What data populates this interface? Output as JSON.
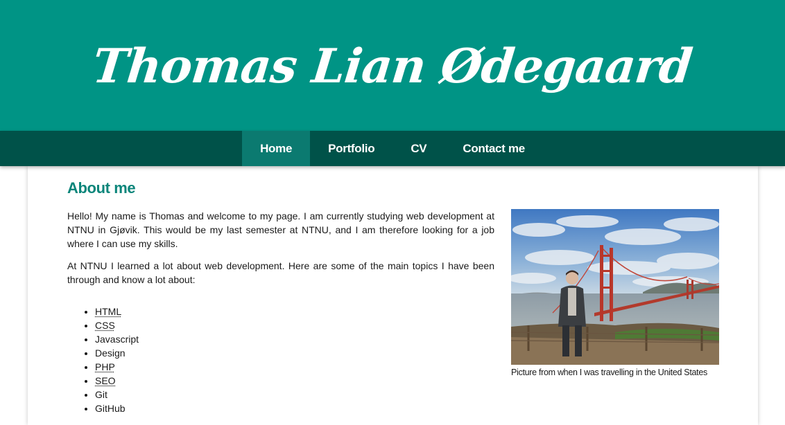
{
  "header": {
    "title": "Thomas Lian Ødegaard"
  },
  "nav": {
    "items": [
      {
        "label": "Home",
        "active": true
      },
      {
        "label": "Portfolio",
        "active": false
      },
      {
        "label": "CV",
        "active": false
      },
      {
        "label": "Contact me",
        "active": false
      }
    ]
  },
  "about": {
    "heading": "About me",
    "paragraphs": [
      "Hello! My name is Thomas and welcome to my page. I am currently studying web development at NTNU in Gjøvik. This would be my last semester at NTNU, and I am therefore looking for a job where I can use my skills.",
      "At NTNU I learned a lot about web development. Here are some of the main topics I have been through and know a lot about:"
    ],
    "skills": [
      "HTML",
      "CSS",
      "Javascript",
      "Design",
      "PHP",
      "SEO",
      "Git",
      "GitHub"
    ],
    "image_caption": "Picture from when I was travelling in the United States"
  },
  "colors": {
    "header_bg": "#009485",
    "nav_bg": "#005249",
    "nav_active_bg": "#0b7a70",
    "heading": "#0a857a"
  }
}
